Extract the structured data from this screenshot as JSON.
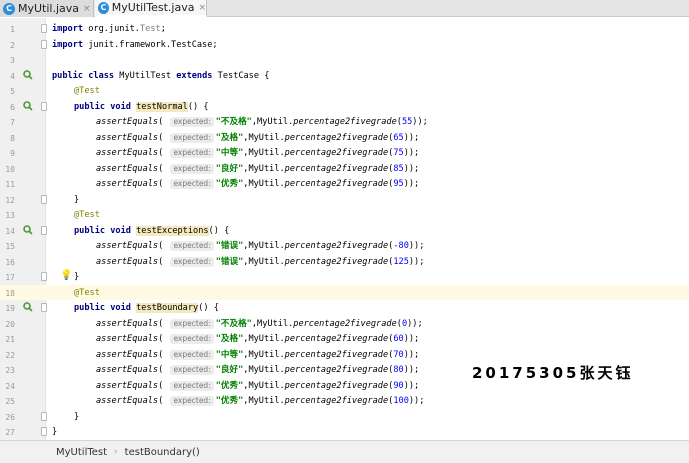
{
  "tabs": [
    {
      "icon": "C",
      "label": "MyUtil.java",
      "close": "×"
    },
    {
      "icon": "C",
      "label": "MyUtilTest.java",
      "close": "×"
    }
  ],
  "editor": {
    "line_numbers": [
      "1",
      "2",
      "3",
      "4",
      "5",
      "6",
      "7",
      "8",
      "9",
      "10",
      "11",
      "12",
      "13",
      "14",
      "15",
      "16",
      "17",
      "18",
      "19",
      "20",
      "21",
      "22",
      "23",
      "24",
      "25",
      "26",
      "27"
    ],
    "imports": [
      {
        "kw": "import",
        "pkg": "org.junit.",
        "cls": "Test",
        "end": ";"
      },
      {
        "kw": "import",
        "pkg": "junit.framework.TestCase",
        "cls": "",
        "end": ";"
      }
    ],
    "class_decl": {
      "kw1": "public",
      "kw2": "class",
      "name": "MyUtilTest",
      "kw3": "extends",
      "parent": "TestCase",
      "brace": "{"
    },
    "annotation": "@Test",
    "method_kw": "public void",
    "methods": [
      {
        "name": "testNormal",
        "sig": "() {"
      },
      {
        "name": "testExceptions",
        "sig": "() {"
      },
      {
        "name": "testBoundary",
        "sig": "() {"
      }
    ],
    "assert_fn": "assertEquals",
    "hint_label": "expected:",
    "call_prefix": "MyUtil.",
    "call_fn": "percentage2fivegrade",
    "asserts_normal": [
      {
        "expected": "\"不及格\"",
        "arg": "55"
      },
      {
        "expected": "\"及格\"",
        "arg": "65"
      },
      {
        "expected": "\"中等\"",
        "arg": "75"
      },
      {
        "expected": "\"良好\"",
        "arg": "85"
      },
      {
        "expected": "\"优秀\"",
        "arg": "95"
      }
    ],
    "asserts_exceptions": [
      {
        "expected": "\"错误\"",
        "arg": "-80"
      },
      {
        "expected": "\"错误\"",
        "arg": "125"
      }
    ],
    "asserts_boundary": [
      {
        "expected": "\"不及格\"",
        "arg": "0"
      },
      {
        "expected": "\"及格\"",
        "arg": "60"
      },
      {
        "expected": "\"中等\"",
        "arg": "70"
      },
      {
        "expected": "\"良好\"",
        "arg": "80"
      },
      {
        "expected": "\"优秀\"",
        "arg": "90"
      },
      {
        "expected": "\"优秀\"",
        "arg": "100"
      }
    ],
    "close_brace": "}"
  },
  "watermark": "20175305张天钰",
  "breadcrumb": [
    "MyUtilTest",
    "testBoundary()"
  ],
  "breadcrumb_sep": "›",
  "colors": {
    "keyword": "#000080",
    "string": "#008000",
    "number": "#0000ff",
    "annotation": "#808000",
    "current_line": "#fffae3"
  }
}
